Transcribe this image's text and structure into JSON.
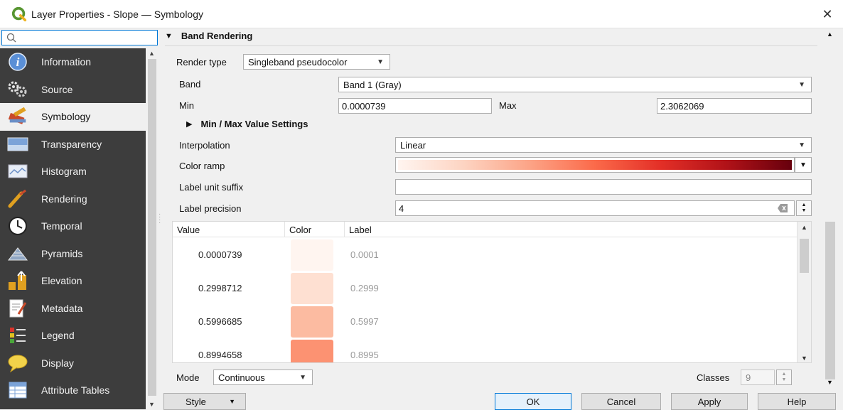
{
  "window": {
    "title": "Layer Properties - Slope — Symbology",
    "close_glyph": "✕"
  },
  "sidebar": {
    "search_value": "",
    "items": [
      {
        "label": "Information",
        "icon": "information-icon"
      },
      {
        "label": "Source",
        "icon": "source-icon"
      },
      {
        "label": "Symbology",
        "icon": "symbology-icon",
        "active": true
      },
      {
        "label": "Transparency",
        "icon": "transparency-icon"
      },
      {
        "label": "Histogram",
        "icon": "histogram-icon"
      },
      {
        "label": "Rendering",
        "icon": "rendering-icon"
      },
      {
        "label": "Temporal",
        "icon": "temporal-icon"
      },
      {
        "label": "Pyramids",
        "icon": "pyramids-icon"
      },
      {
        "label": "Elevation",
        "icon": "elevation-icon"
      },
      {
        "label": "Metadata",
        "icon": "metadata-icon"
      },
      {
        "label": "Legend",
        "icon": "legend-icon"
      },
      {
        "label": "Display",
        "icon": "display-icon"
      },
      {
        "label": "Attribute Tables",
        "icon": "attribute-tables-icon"
      }
    ]
  },
  "band_rendering": {
    "header": "Band Rendering",
    "render_type_label": "Render type",
    "render_type_value": "Singleband pseudocolor",
    "band_label": "Band",
    "band_value": "Band 1 (Gray)",
    "min_label": "Min",
    "min_value": "0.0000739",
    "max_label": "Max",
    "max_value": "2.3062069",
    "minmax_header": "Min / Max Value Settings",
    "interpolation_label": "Interpolation",
    "interpolation_value": "Linear",
    "color_ramp_label": "Color ramp",
    "label_unit_suffix_label": "Label unit suffix",
    "label_unit_suffix_value": "",
    "label_precision_label": "Label precision",
    "label_precision_value": "4"
  },
  "table": {
    "columns": [
      "Value",
      "Color",
      "Label"
    ],
    "rows": [
      {
        "value": "0.0000739",
        "color": "#fff5f0",
        "label": "0.0001"
      },
      {
        "value": "0.2998712",
        "color": "#fee0d2",
        "label": "0.2999"
      },
      {
        "value": "0.5996685",
        "color": "#fcbba1",
        "label": "0.5997"
      },
      {
        "value": "0.8994658",
        "color": "#fc9272",
        "label": "0.8995"
      }
    ]
  },
  "mode": {
    "label": "Mode",
    "value": "Continuous"
  },
  "classes": {
    "label": "Classes",
    "value": "9"
  },
  "buttons": {
    "style": "Style",
    "ok": "OK",
    "cancel": "Cancel",
    "apply": "Apply",
    "help": "Help"
  },
  "colors": {
    "sidebar_bg": "#3d3d3d",
    "accent": "#0078d7"
  }
}
